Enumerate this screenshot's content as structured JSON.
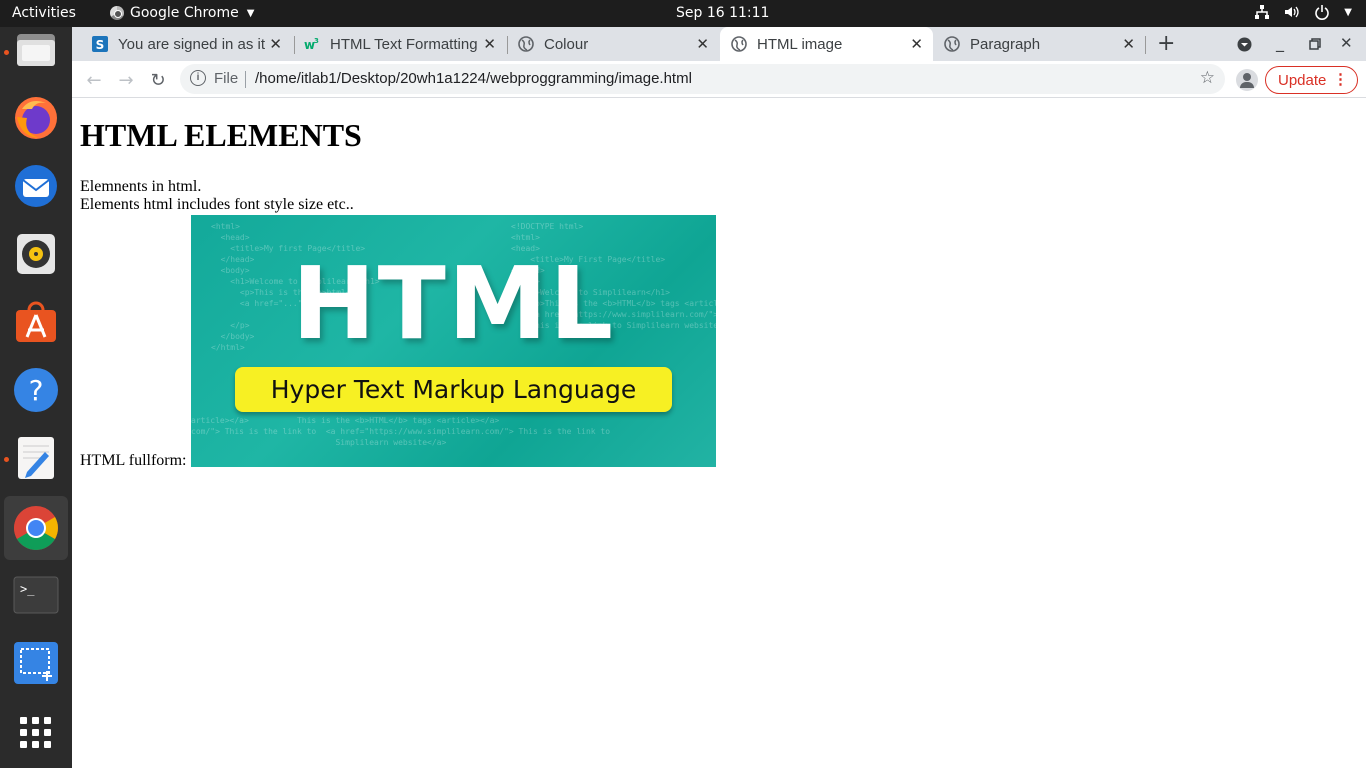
{
  "topbar": {
    "activities": "Activities",
    "app_name": "Google Chrome",
    "clock": "Sep 16  11:11"
  },
  "dock": {
    "items": [
      {
        "icon": "files-icon",
        "running": true
      },
      {
        "icon": "firefox-icon",
        "running": true
      },
      {
        "icon": "thunderbird-icon",
        "running": false
      },
      {
        "icon": "rhythmbox-icon",
        "running": false
      },
      {
        "icon": "software-center-icon",
        "running": false
      },
      {
        "icon": "help-icon",
        "running": false
      },
      {
        "icon": "text-editor-icon",
        "running": true
      },
      {
        "icon": "chrome-icon",
        "running": true,
        "active": true
      },
      {
        "icon": "terminal-icon",
        "running": false
      },
      {
        "icon": "screenshot-icon",
        "running": false
      },
      {
        "icon": "show-apps-icon",
        "running": false
      }
    ]
  },
  "browser": {
    "tabs": [
      {
        "title": "You are signed in as it",
        "favicon": "simplilearn-icon"
      },
      {
        "title": "HTML Text Formatting",
        "favicon": "w3schools-icon"
      },
      {
        "title": "Colour",
        "favicon": "globe-icon"
      },
      {
        "title": "HTML image",
        "favicon": "globe-icon",
        "active": true
      },
      {
        "title": "Paragraph",
        "favicon": "globe-icon"
      }
    ],
    "omnibox": {
      "scheme_label": "File",
      "url": "/home/itlab1/Desktop/20wh1a1224/webproggramming/image.html"
    },
    "update_label": "Update"
  },
  "page": {
    "heading": "HTML ELEMENTS",
    "line1": "Elemnents in html.",
    "line2": "Elements html includes font style size etc..",
    "image_label": "HTML fullform:",
    "image": {
      "big_text": "HTML",
      "pill_text": "Hyper Text Markup Language",
      "bg_color": "#13a99a",
      "pill_color": "#f7f023"
    }
  },
  "colors": {
    "topbar_bg": "#1d1d1d",
    "dock_bg": "#2b2b2b",
    "tabstrip_bg": "#dee1e6",
    "update_red": "#d93025",
    "running_dot": "#e95420"
  }
}
